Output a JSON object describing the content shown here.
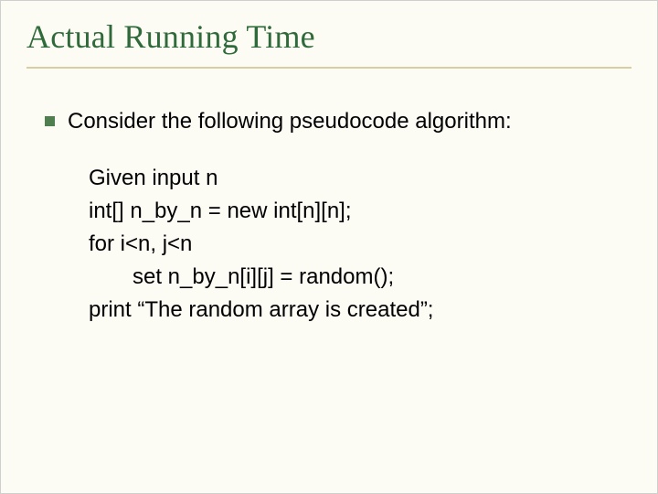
{
  "slide": {
    "title": "Actual Running Time",
    "bullet": "Consider the following pseudocode algorithm:",
    "code": {
      "l1": "Given input n",
      "l2": "int[] n_by_n = new int[n][n];",
      "l3": "for i<n, j<n",
      "l4": "set n_by_n[i][j] = random();",
      "l5": "print “The random array is created”;"
    }
  }
}
